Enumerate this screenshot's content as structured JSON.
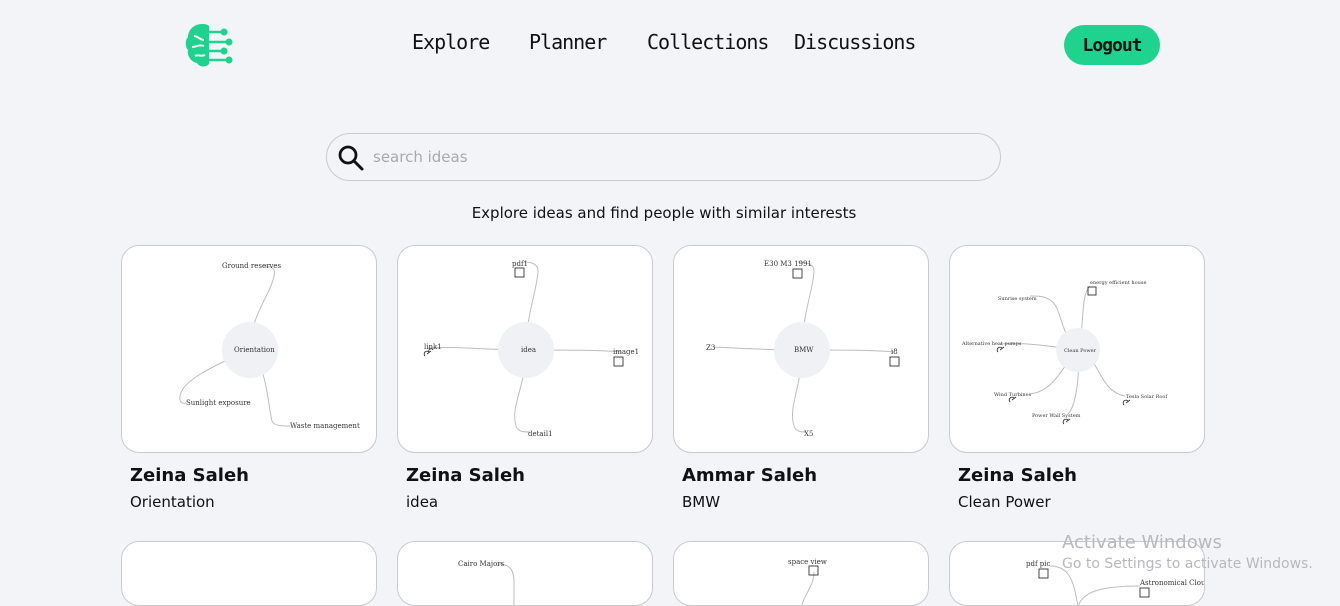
{
  "nav": {
    "explore": "Explore",
    "planner": "Planner",
    "collections": "Collections",
    "discussions": "Discussions",
    "logout": "Logout"
  },
  "search": {
    "placeholder": "search ideas"
  },
  "tagline": "Explore ideas and find people with similar interests",
  "colors": {
    "accent": "#1fd38f",
    "background": "#f3f4f8"
  },
  "cards": [
    {
      "owner": "Zeina Saleh",
      "title": "Orientation",
      "map": {
        "center": "Orientation",
        "nodes": [
          "Ground reserves",
          "Sunlight exposure",
          "Waste management"
        ]
      }
    },
    {
      "owner": "Zeina Saleh",
      "title": "idea",
      "map": {
        "center": "idea",
        "nodes": [
          "pdf1",
          "link1",
          "image1",
          "detail1"
        ]
      }
    },
    {
      "owner": "Ammar Saleh",
      "title": "BMW",
      "map": {
        "center": "BMW",
        "nodes": [
          "E30 M3 1991",
          "Z3",
          "i8",
          "X5"
        ]
      }
    },
    {
      "owner": "Zeina Saleh",
      "title": "Clean Power",
      "map": {
        "center": "Clean Power",
        "nodes": [
          "Sunrise system",
          "energy efficient house",
          "Alternative heat pumps",
          "Wind Turbines",
          "Power Wall System",
          "Tesla Solar Roof"
        ]
      }
    }
  ],
  "cards_row2": [
    {
      "nodes": []
    },
    {
      "nodes": [
        "Cairo Majors"
      ]
    },
    {
      "nodes": [
        "space view"
      ]
    },
    {
      "nodes": [
        "pdf pic",
        "Astronomical Clouds"
      ]
    }
  ],
  "watermark": {
    "title": "Activate Windows",
    "subtitle": "Go to Settings to activate Windows."
  }
}
